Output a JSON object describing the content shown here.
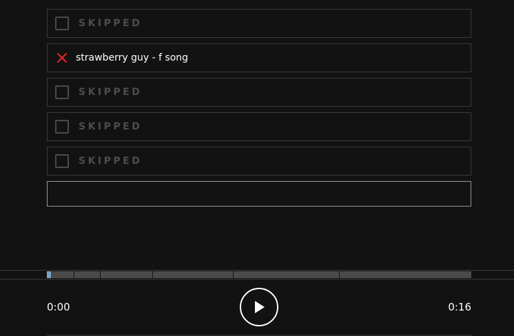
{
  "guesses": [
    {
      "status": "skipped",
      "label": "SKIPPED"
    },
    {
      "status": "wrong",
      "label": "strawberry guy - f song"
    },
    {
      "status": "skipped",
      "label": "SKIPPED"
    },
    {
      "status": "skipped",
      "label": "SKIPPED"
    },
    {
      "status": "skipped",
      "label": "SKIPPED"
    }
  ],
  "input": {
    "value": "",
    "placeholder": ""
  },
  "player": {
    "current_time": "0:00",
    "total_time": "0:16",
    "progress_fraction": 0.01,
    "play_icon": "play-icon"
  },
  "icons": {
    "wrong": "x-icon",
    "skipped": "checkbox-icon"
  },
  "colors": {
    "background": "#121212",
    "wrong_mark": "#e02424",
    "progress_fill": "#7aa3c4",
    "track": "#4a4a4a",
    "skipped_text": "#4d4d4d"
  }
}
